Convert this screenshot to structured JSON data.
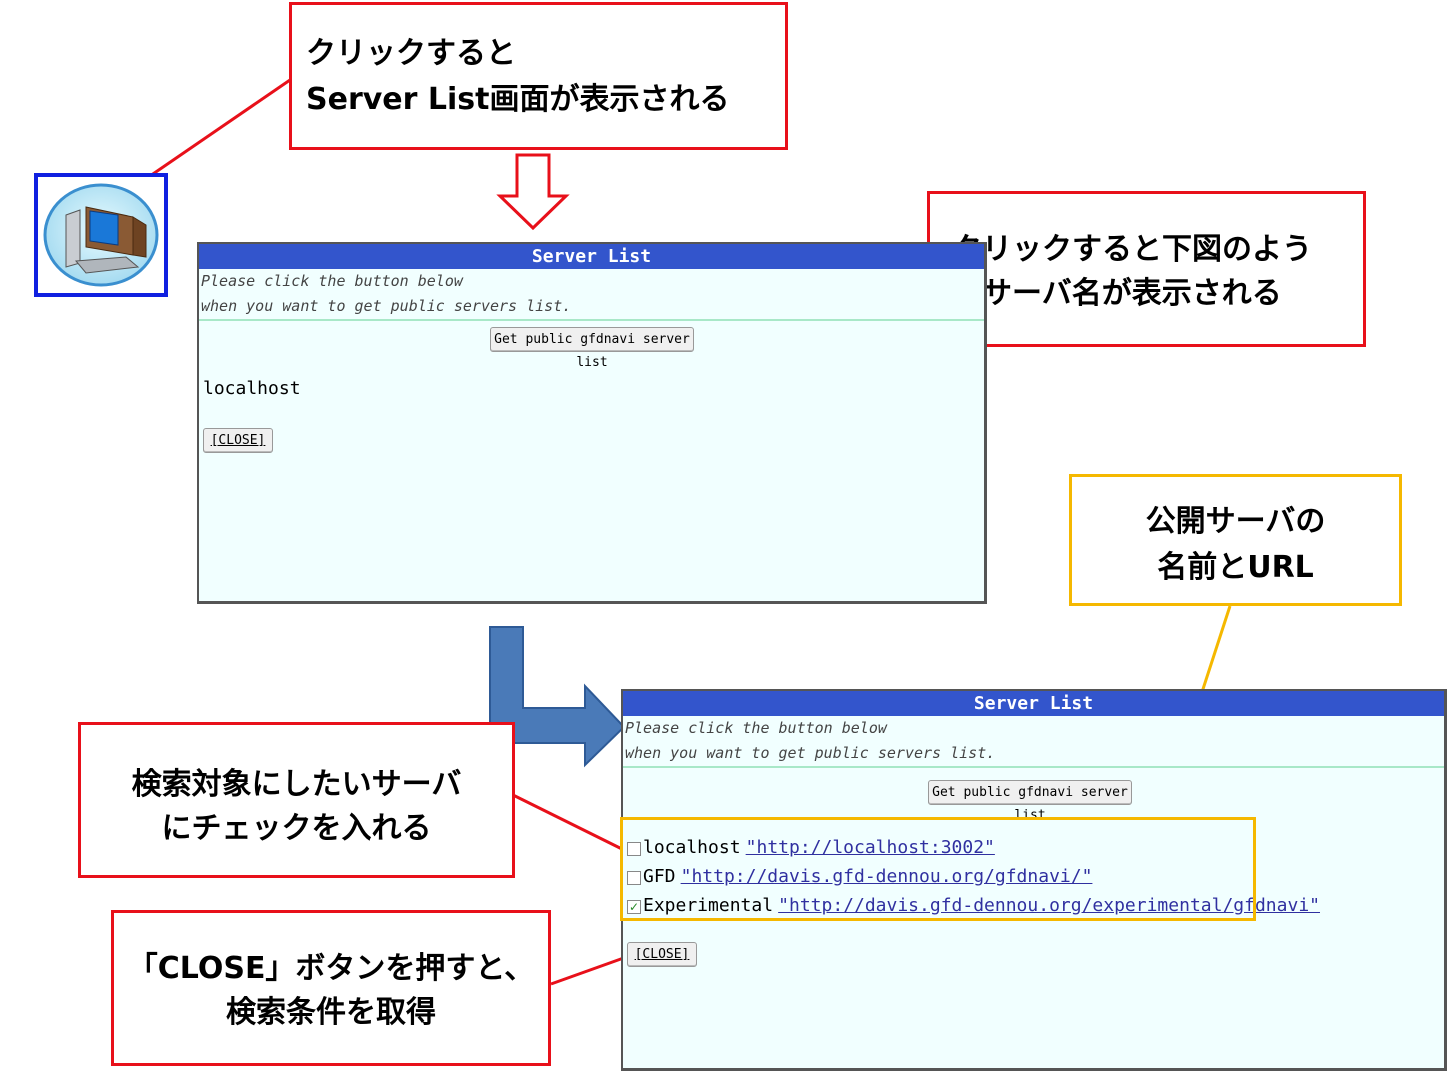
{
  "callouts": {
    "top_line1": "クリックすると",
    "top_line2": "Server List画面が表示される",
    "right_line1": "クリックすると下図のよう",
    "right_line2": "にサーバ名が表示される",
    "public_line1": "公開サーバの",
    "public_line2": "名前とURL",
    "check_line1": "検索対象にしたいサーバ",
    "check_line2": "にチェックを入れる",
    "close_line1": "「CLOSE」ボタンを押すと、",
    "close_line2": "検索条件を取得"
  },
  "icon": "server-computer-icon",
  "window1": {
    "title": "Server List",
    "msg_line1": "Please click the button below",
    "msg_line2": "when you want to get public servers list.",
    "get_button": "Get public gfdnavi server list",
    "server": "localhost",
    "close_button": "[CLOSE]"
  },
  "window2": {
    "title": "Server List",
    "msg_line1": "Please click the button below",
    "msg_line2": "when you want to get public servers list.",
    "get_button": "Get public gfdnavi server list",
    "servers": [
      {
        "name": "localhost",
        "url": "\"http://localhost:3002\"",
        "checked": false
      },
      {
        "name": "GFD",
        "url": "\"http://davis.gfd-dennou.org/gfdnavi/\"",
        "checked": false
      },
      {
        "name": "Experimental",
        "url": "\"http://davis.gfd-dennou.org/experimental/gfdnavi\"",
        "checked": true
      }
    ],
    "close_button": "[CLOSE]"
  },
  "colors": {
    "callout_red": "#e8101a",
    "callout_yellow": "#f5b800",
    "title_bar": "#3355cc",
    "arrow_blue": "#4a7ab8"
  }
}
